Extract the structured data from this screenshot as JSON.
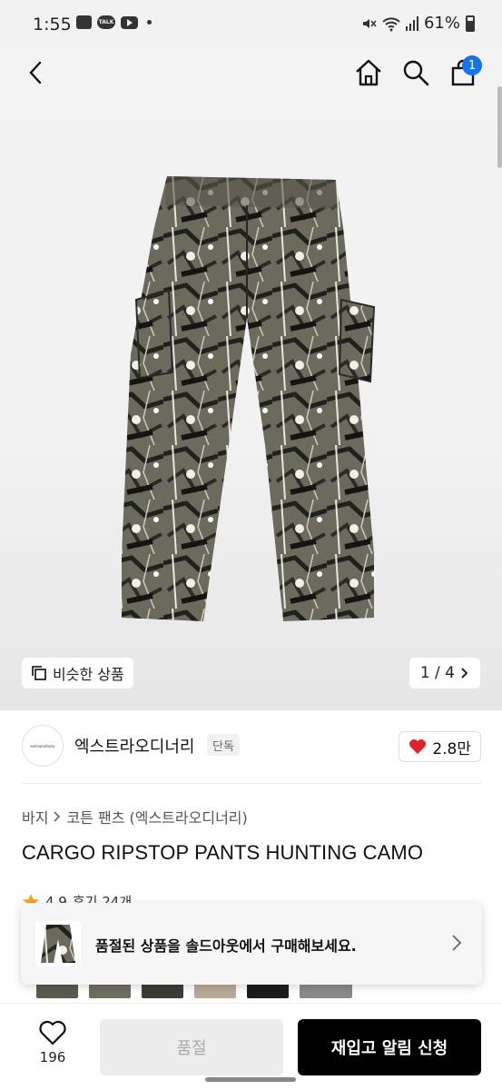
{
  "status_bar": {
    "time": "1:55",
    "talk_label": "TALK",
    "battery": "61%"
  },
  "nav": {
    "cart_count": "1",
    "accent_color": "#1473f1"
  },
  "gallery": {
    "similar_label": "비슷한 상품",
    "page_indicator": "1 / 4"
  },
  "brand": {
    "logo_text": "extraordinary",
    "name": "엑스트라오디너리",
    "tag": "단독",
    "likes": "2.8만"
  },
  "product": {
    "breadcrumb": [
      "바지",
      "코튼 팬츠 (엑스트라오디너리)"
    ],
    "title": "CARGO RIPSTOP PANTS HUNTING CAMO",
    "rating": "4.9",
    "review_label": "후기 24개"
  },
  "soldout_banner": {
    "text": "품절된 상품을 솔드아웃에서 구매해보세요."
  },
  "bottom_bar": {
    "favorite_count": "196",
    "soldout_label": "품절",
    "restock_label": "재입고 알림 신청"
  }
}
